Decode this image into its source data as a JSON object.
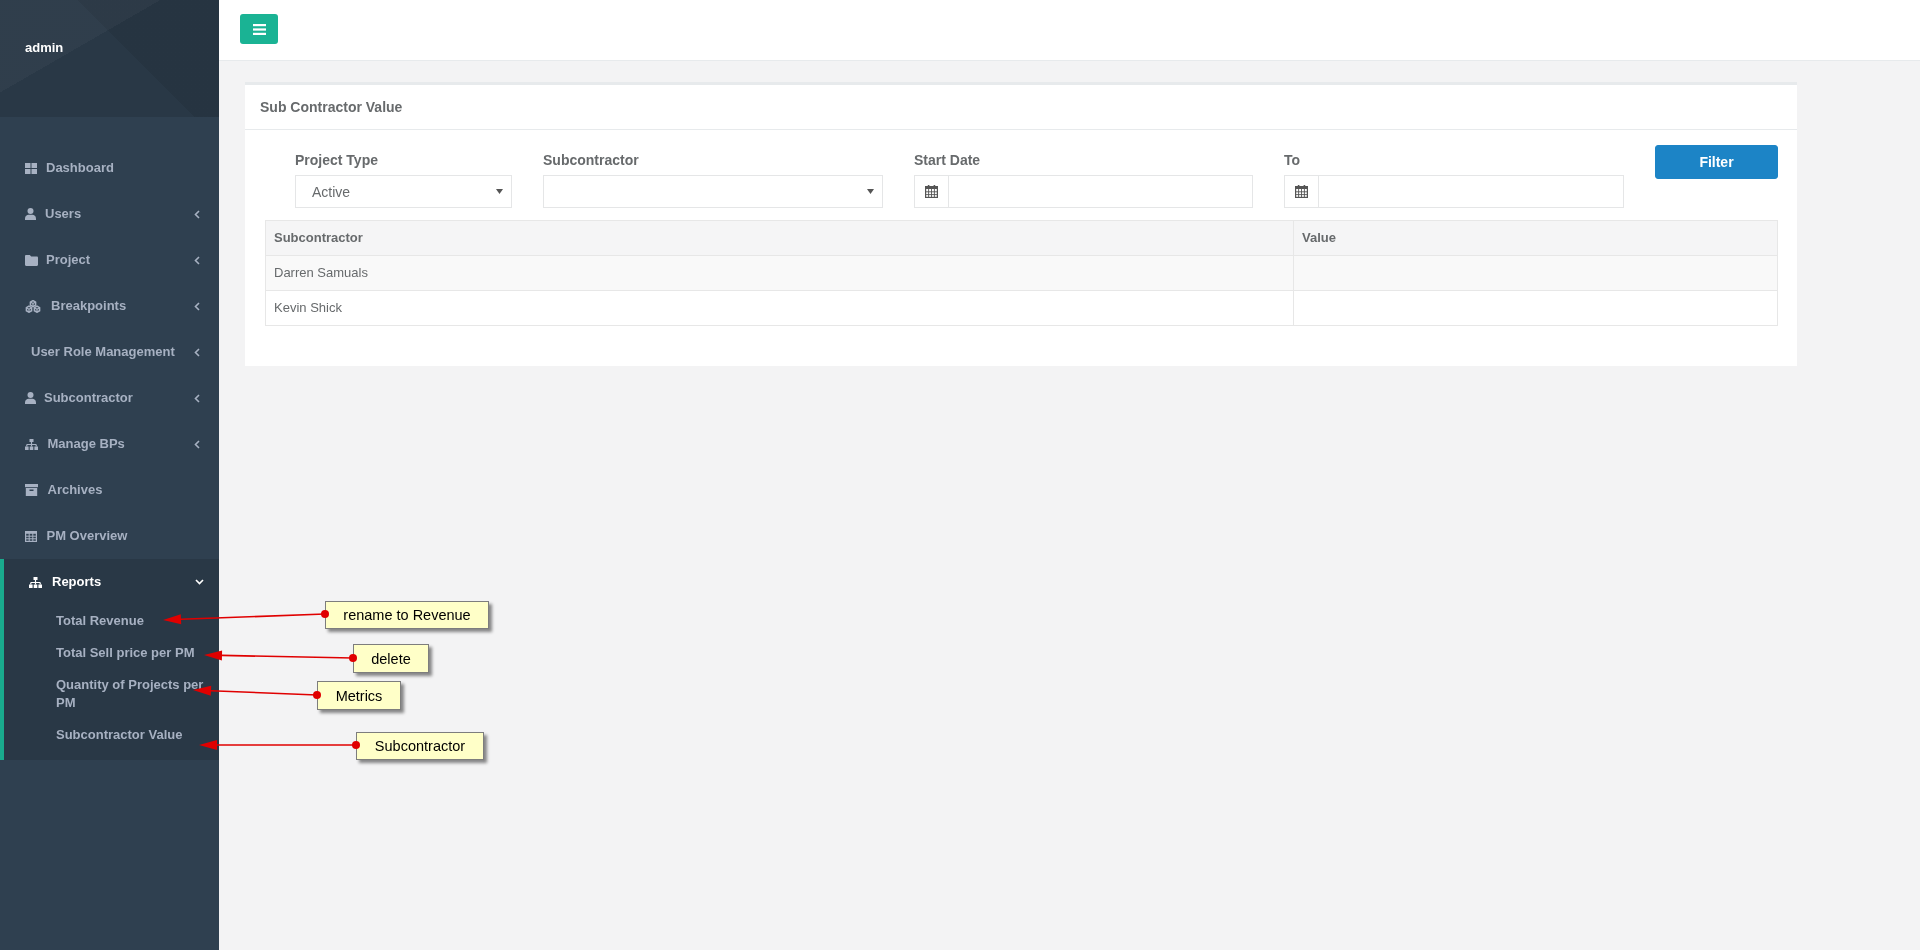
{
  "sidebar": {
    "user": "admin",
    "items": [
      {
        "label": "Dashboard",
        "kind": "link",
        "selected": false
      },
      {
        "label": "Users",
        "kind": "menu",
        "expanded": false,
        "selected": false
      },
      {
        "label": "Project",
        "kind": "menu",
        "expanded": false,
        "selected": false
      },
      {
        "label": "Breakpoints",
        "kind": "menu",
        "expanded": false,
        "selected": false
      },
      {
        "label": "User Role Management",
        "kind": "menu",
        "expanded": false,
        "selected": false
      },
      {
        "label": "Subcontractor",
        "kind": "menu",
        "expanded": false,
        "selected": false
      },
      {
        "label": "Manage BPs",
        "kind": "menu",
        "expanded": false,
        "selected": false
      },
      {
        "label": "Archives",
        "kind": "link",
        "selected": false
      },
      {
        "label": "PM Overview",
        "kind": "link",
        "selected": false
      },
      {
        "label": "Reports",
        "kind": "menu",
        "expanded": true,
        "selected": true,
        "children": [
          {
            "label": "Total Revenue"
          },
          {
            "label": "Total Sell price per PM"
          },
          {
            "label": "Quantity of Projects per PM"
          },
          {
            "label": "Subcontractor Value"
          }
        ]
      }
    ]
  },
  "panel": {
    "title": "Sub Contractor Value",
    "filters": [
      {
        "kind": "select",
        "label": "Project Type",
        "value": "Active"
      },
      {
        "kind": "select",
        "label": "Subcontractor"
      },
      {
        "kind": "date",
        "label": "Start Date"
      },
      {
        "kind": "date",
        "label": "To"
      }
    ],
    "filter_button": "Filter",
    "table": {
      "columns": [
        "Subcontractor",
        "Value"
      ],
      "rows": [
        [
          "Darren Samuals"
        ],
        [
          "Kevin Shick"
        ]
      ]
    }
  },
  "annotations": [
    {
      "text": "rename to Revenue"
    },
    {
      "text": "delete"
    },
    {
      "text": "Metrics"
    },
    {
      "text": "Subcontractor"
    }
  ]
}
